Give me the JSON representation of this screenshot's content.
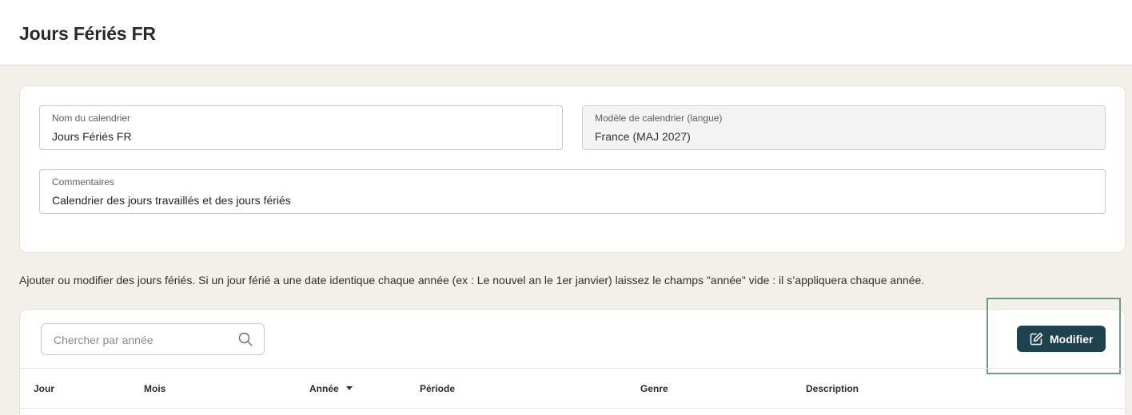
{
  "header": {
    "title": "Jours Fériés FR"
  },
  "form": {
    "name_label": "Nom du calendrier",
    "name_value": "Jours Fériés FR",
    "model_label": "Modèle de calendrier (langue)",
    "model_value": "France (MAJ 2027)",
    "comments_label": "Commentaires",
    "comments_value": "Calendrier des jours travaillés et des jours fériés"
  },
  "hint": "Ajouter ou modifier des jours fériés. Si un jour férié a une date identique chaque année (ex : Le nouvel an le 1er janvier) laissez le champs \"année\" vide : il s’appliquera chaque année.",
  "toolbar": {
    "search_placeholder": "Chercher par année",
    "edit_label": "Modifier"
  },
  "table": {
    "columns": [
      "Jour",
      "Mois",
      "Année",
      "Période",
      "Genre",
      "Description"
    ],
    "sorted_column": "Année",
    "sort_direction": "descending"
  },
  "colors": {
    "accent": "#1f4250",
    "background": "#f3f0ea",
    "highlight": "#6f9a85"
  }
}
